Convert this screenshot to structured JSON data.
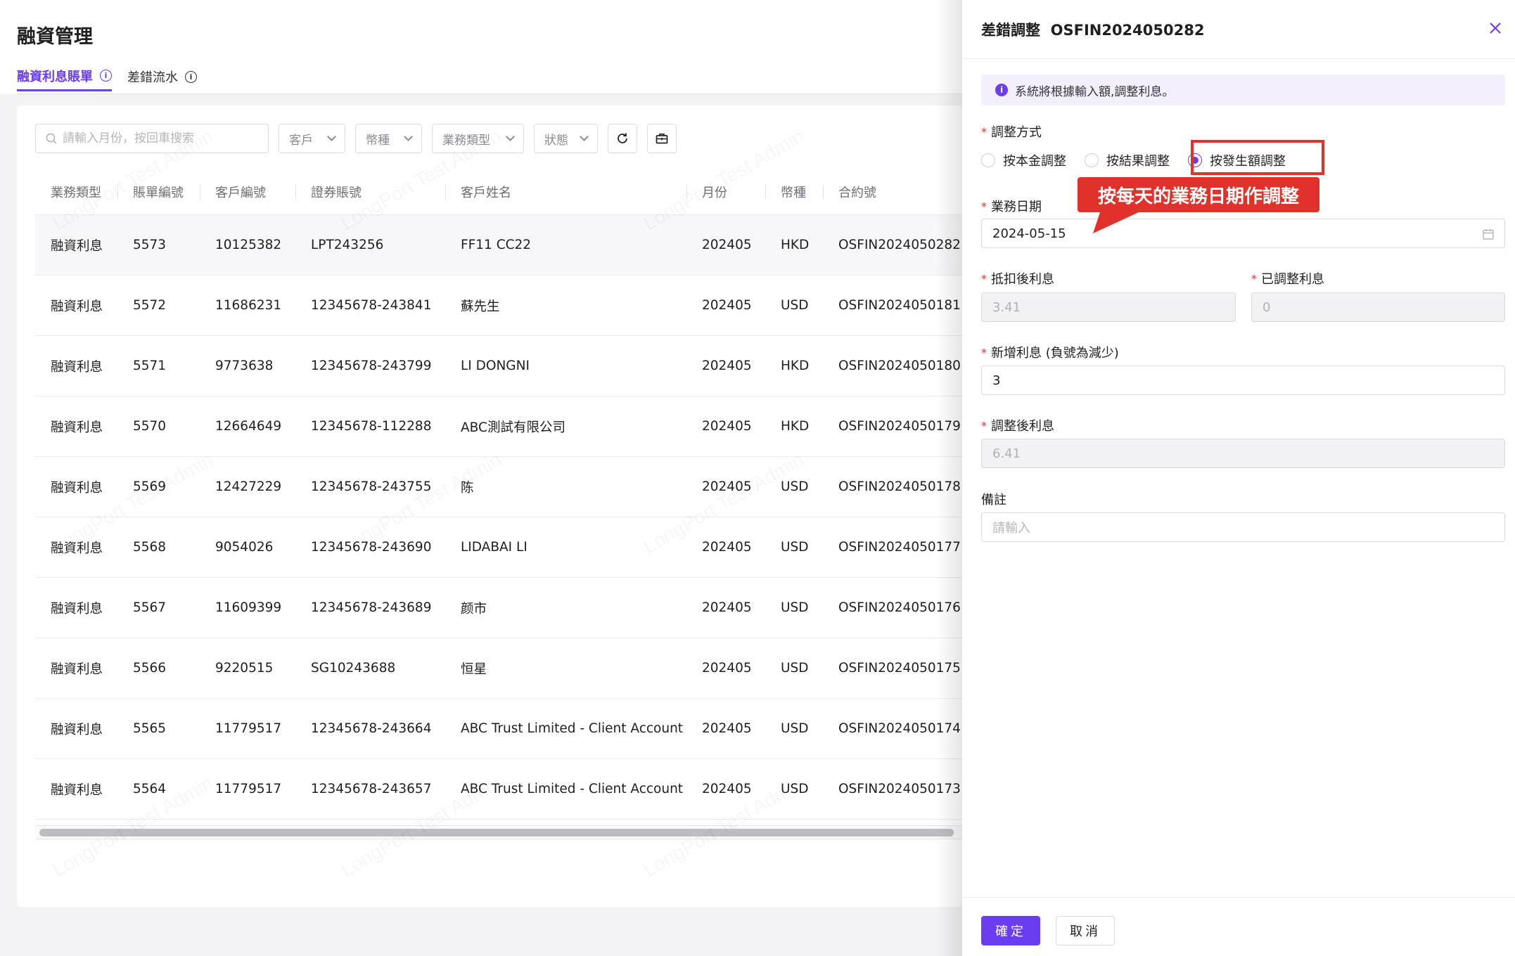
{
  "page": {
    "title": "融資管理",
    "tabs": [
      {
        "label": "融資利息賬單",
        "active": true
      },
      {
        "label": "差錯流水",
        "active": false
      }
    ]
  },
  "toolbar": {
    "search_placeholder": "請輸入月份，按回車搜索",
    "filters": [
      "客戶",
      "幣種",
      "業務類型",
      "狀態"
    ]
  },
  "table": {
    "columns": [
      "業務類型",
      "賬單編號",
      "客戶編號",
      "證券賬號",
      "客戶姓名",
      "月份",
      "幣種",
      "合約號"
    ],
    "rows": [
      [
        "融資利息",
        "5573",
        "10125382",
        "LPT243256",
        "FF11 CC22",
        "202405",
        "HKD",
        "OSFIN2024050282"
      ],
      [
        "融資利息",
        "5572",
        "11686231",
        "12345678-243841",
        "蘇先生",
        "202405",
        "USD",
        "OSFIN2024050181"
      ],
      [
        "融資利息",
        "5571",
        "9773638",
        "12345678-243799",
        "LI DONGNI",
        "202405",
        "HKD",
        "OSFIN2024050180"
      ],
      [
        "融資利息",
        "5570",
        "12664649",
        "12345678-112288",
        "ABC測試有限公司",
        "202405",
        "HKD",
        "OSFIN2024050179"
      ],
      [
        "融資利息",
        "5569",
        "12427229",
        "12345678-243755",
        "陈",
        "202405",
        "USD",
        "OSFIN2024050178"
      ],
      [
        "融資利息",
        "5568",
        "9054026",
        "12345678-243690",
        "LIDABAI LI",
        "202405",
        "USD",
        "OSFIN2024050177"
      ],
      [
        "融資利息",
        "5567",
        "11609399",
        "12345678-243689",
        "颜市",
        "202405",
        "USD",
        "OSFIN2024050176"
      ],
      [
        "融資利息",
        "5566",
        "9220515",
        "SG10243688",
        "恒星",
        "202405",
        "USD",
        "OSFIN2024050175"
      ],
      [
        "融資利息",
        "5565",
        "11779517",
        "12345678-243664",
        "ABC Trust Limited - Client Account",
        "202405",
        "USD",
        "OSFIN2024050174"
      ],
      [
        "融資利息",
        "5564",
        "11779517",
        "12345678-243657",
        "ABC Trust Limited - Client Account",
        "202405",
        "USD",
        "OSFIN2024050173"
      ]
    ]
  },
  "drawer": {
    "title": "差錯調整  OSFIN2024050282",
    "alert": "系統將根據輸入額,調整利息。",
    "adjust_method_label": "調整方式",
    "radio_options": [
      {
        "label": "按本金調整",
        "selected": false
      },
      {
        "label": "按結果調整",
        "selected": false
      },
      {
        "label": "按發生額調整",
        "selected": true
      }
    ],
    "callout": "按每天的業務日期作調整",
    "business_date_label": "業務日期",
    "business_date_value": "2024-05-15",
    "after_deduct_label": "抵扣後利息",
    "after_deduct_value": "3.41",
    "adjusted_label": "已調整利息",
    "adjusted_value": "0",
    "new_interest_label": "新增利息 (負號為減少)",
    "new_interest_value": "3",
    "post_adjust_label": "調整後利息",
    "post_adjust_value": "6.41",
    "remark_label": "備註",
    "remark_placeholder": "請輸入",
    "confirm_label": "確定",
    "cancel_label": "取消"
  },
  "watermark": "LongPort Test Admin",
  "colors": {
    "accent": "#6a3df0",
    "highlight_red": "#e0322a"
  }
}
